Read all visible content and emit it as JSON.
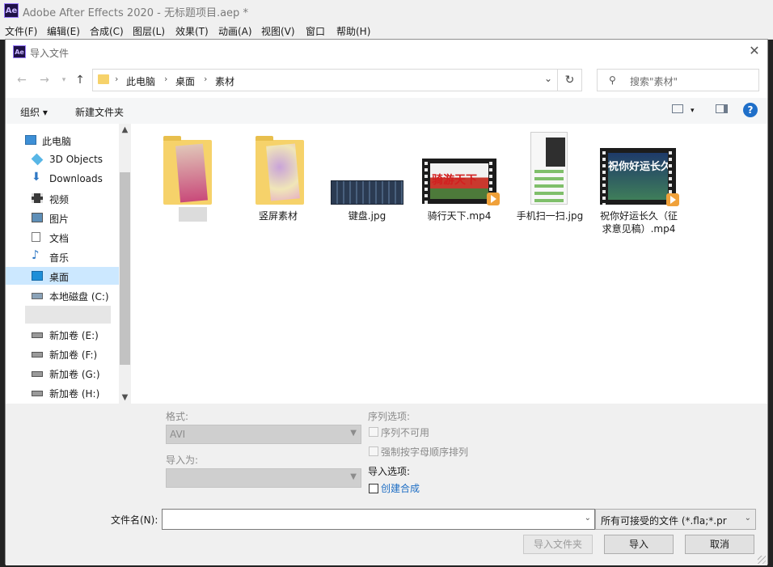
{
  "app": {
    "title": "Adobe After Effects 2020 - 无标题项目.aep *",
    "logo": "Ae",
    "menu": [
      "文件(F)",
      "编辑(E)",
      "合成(C)",
      "图层(L)",
      "效果(T)",
      "动画(A)",
      "视图(V)",
      "窗口",
      "帮助(H)"
    ]
  },
  "dialog": {
    "title": "导入文件",
    "close_icon": "close-icon",
    "breadcrumb": [
      "此电脑",
      "桌面",
      "素材"
    ],
    "search_placeholder": "搜索\"素材\"",
    "organize_label": "组织 ▾",
    "new_folder_label": "新建文件夹",
    "help_label": "?"
  },
  "sidebar": {
    "items": [
      {
        "label": "此电脑",
        "icon": "computer-icon"
      },
      {
        "label": "3D Objects",
        "icon": "cube-icon"
      },
      {
        "label": "Downloads",
        "icon": "download-icon"
      },
      {
        "label": "视频",
        "icon": "video-icon"
      },
      {
        "label": "图片",
        "icon": "picture-icon"
      },
      {
        "label": "文档",
        "icon": "document-icon"
      },
      {
        "label": "音乐",
        "icon": "music-icon"
      },
      {
        "label": "桌面",
        "icon": "desktop-icon",
        "selected": true
      },
      {
        "label": "本地磁盘 (C:)",
        "icon": "drive-icon"
      },
      {
        "label": "",
        "icon": "blurred"
      },
      {
        "label": "新加卷 (E:)",
        "icon": "drive-icon"
      },
      {
        "label": "新加卷 (F:)",
        "icon": "drive-icon"
      },
      {
        "label": "新加卷 (G:)",
        "icon": "drive-icon"
      },
      {
        "label": "新加卷 (H:)",
        "icon": "drive-icon"
      }
    ]
  },
  "files": [
    {
      "name": "",
      "type": "folder"
    },
    {
      "name": "竖屏素材",
      "type": "folder"
    },
    {
      "name": "键盘.jpg",
      "type": "image"
    },
    {
      "name": "骑行天下.mp4",
      "type": "video",
      "thumb_text": "骑游天下"
    },
    {
      "name": "手机扫一扫.jpg",
      "type": "image"
    },
    {
      "name": "祝你好运长久（征求意见稿）.mp4",
      "type": "video",
      "thumb_text": "祝你好运长久"
    }
  ],
  "options": {
    "format_label": "格式:",
    "format_value": "AVI",
    "import_as_label": "导入为:",
    "import_as_value": "",
    "sequence_label": "序列选项:",
    "sequence_unavailable": "序列不可用",
    "force_alpha": "强制按字母顺序排列",
    "import_options_label": "导入选项:",
    "create_comp": "创建合成"
  },
  "footer": {
    "filename_label": "文件名(N):",
    "filename_value": "",
    "filetype_value": "所有可接受的文件 (*.fla;*.pr",
    "import_folder_button": "导入文件夹",
    "import_button": "导入",
    "cancel_button": "取消"
  },
  "colors": {
    "accent": "#1e6ec4",
    "selection": "#cce8ff",
    "folder": "#f6d26a"
  }
}
